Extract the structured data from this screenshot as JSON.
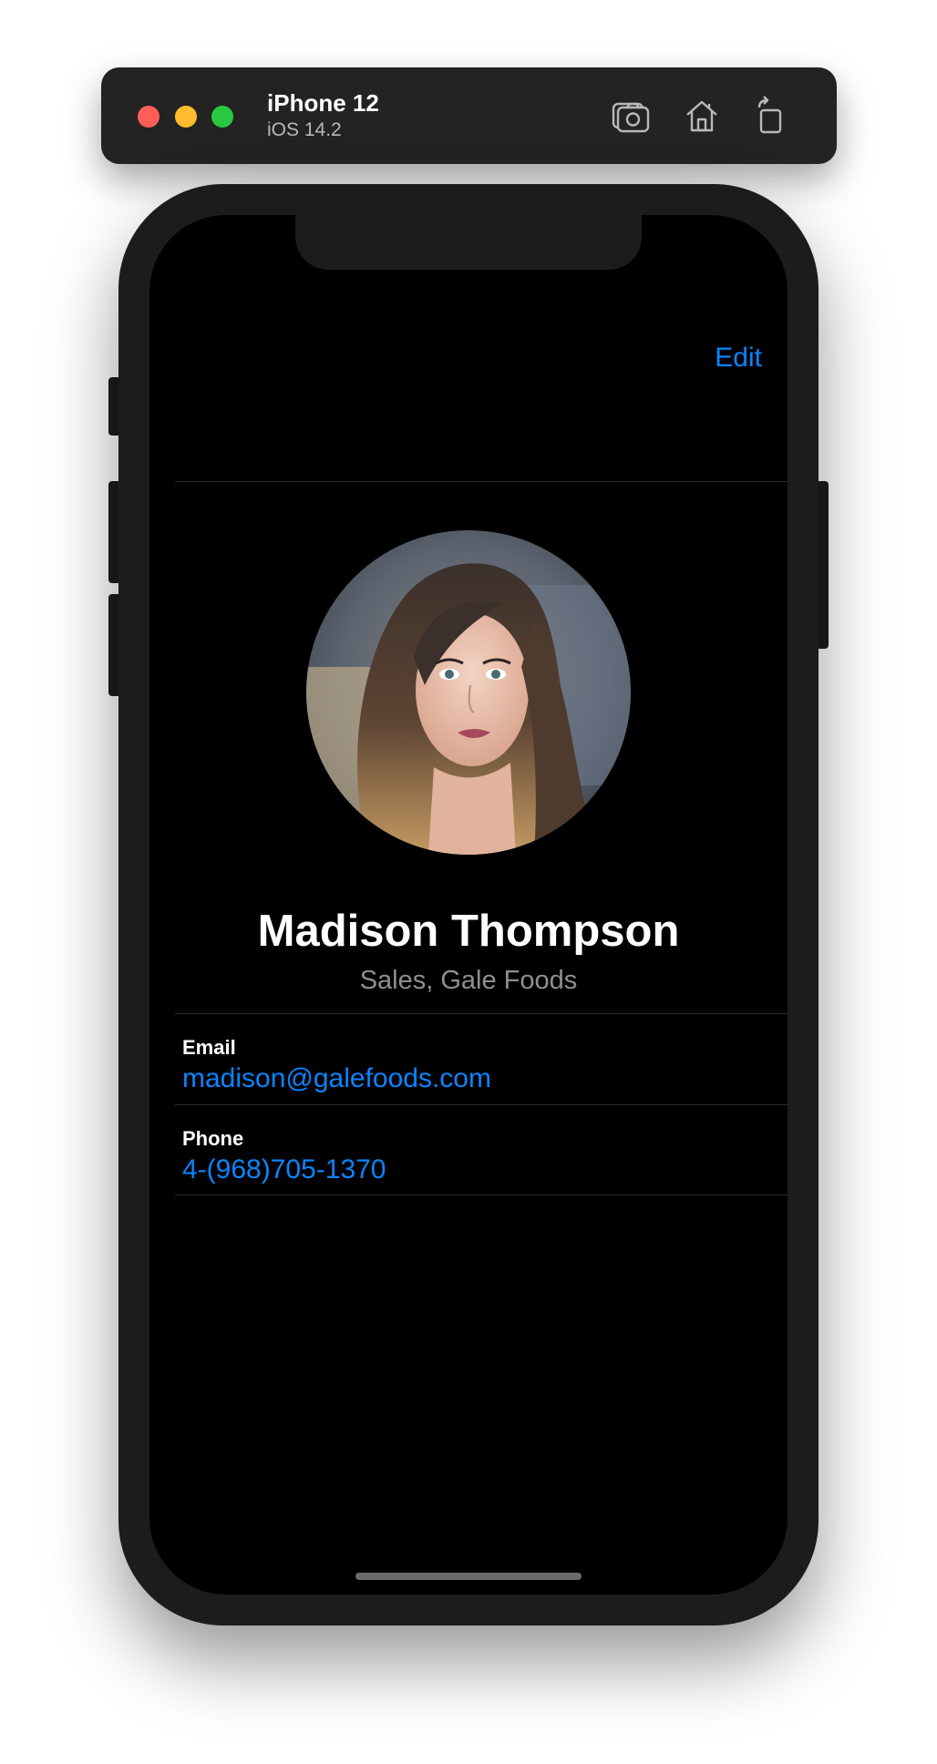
{
  "simulator": {
    "device_name": "iPhone 12",
    "os_version": "iOS 14.2",
    "toolbar_icons": [
      "screenshot-icon",
      "home-icon",
      "rotate-icon"
    ]
  },
  "nav": {
    "edit_label": "Edit"
  },
  "contact": {
    "name": "Madison Thompson",
    "subtitle": "Sales, Gale Foods",
    "details": [
      {
        "label": "Email",
        "value": "madison@galefoods.com"
      },
      {
        "label": "Phone",
        "value": "4-(968)705-1370"
      }
    ]
  },
  "colors": {
    "accent": "#0a84ff",
    "background": "#000000",
    "secondary_text": "#8e8e93"
  }
}
